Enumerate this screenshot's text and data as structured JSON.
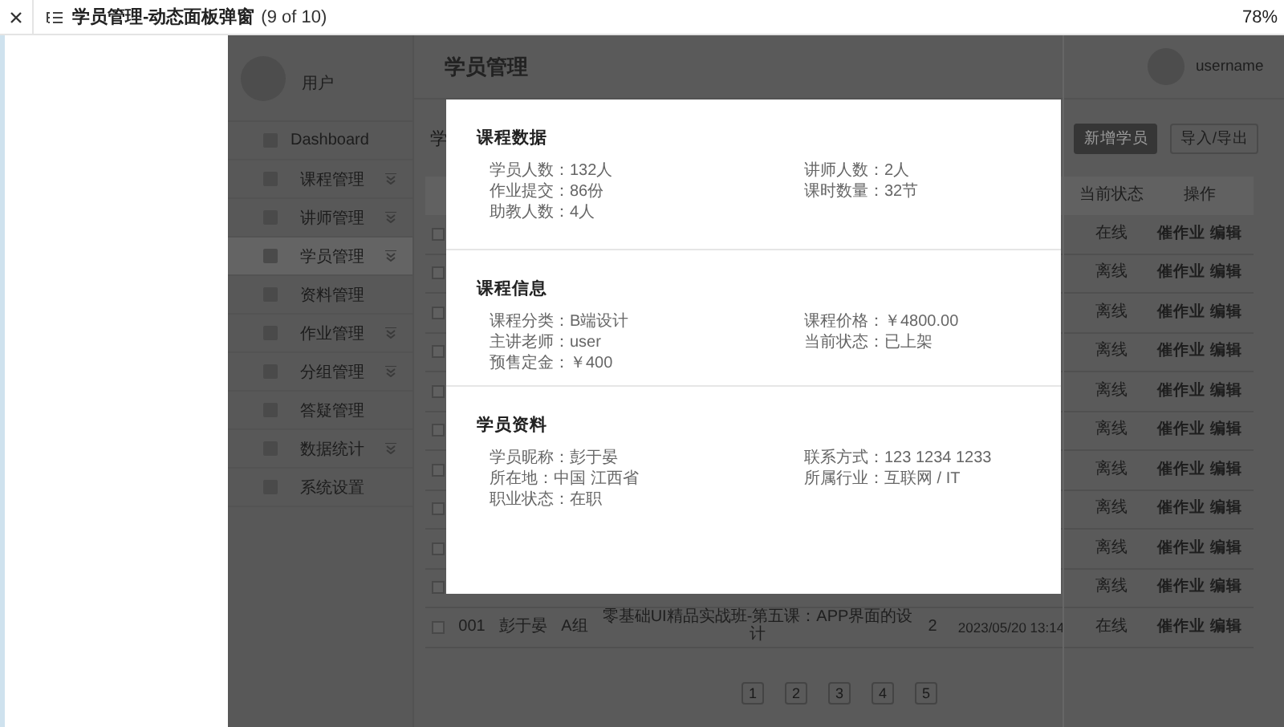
{
  "viewer": {
    "title": "学员管理-动态面板弹窗",
    "page_count": "(9 of 10)",
    "zoom": "78%"
  },
  "sidebar": {
    "user": "用户",
    "items": [
      {
        "label": "Dashboard",
        "expandable": false,
        "selected": false
      },
      {
        "label": "课程管理",
        "expandable": true,
        "selected": false
      },
      {
        "label": "讲师管理",
        "expandable": true,
        "selected": false
      },
      {
        "label": "学员管理",
        "expandable": true,
        "selected": true
      },
      {
        "label": "资料管理",
        "expandable": false,
        "selected": false
      },
      {
        "label": "作业管理",
        "expandable": true,
        "selected": false
      },
      {
        "label": "分组管理",
        "expandable": true,
        "selected": false
      },
      {
        "label": "答疑管理",
        "expandable": false,
        "selected": false
      },
      {
        "label": "数据统计",
        "expandable": true,
        "selected": false
      },
      {
        "label": "系统设置",
        "expandable": false,
        "selected": false
      }
    ]
  },
  "header": {
    "title": "学员管理",
    "username": "username"
  },
  "toolbar": {
    "section_title": "学",
    "buttons": [
      {
        "label": "新增学员",
        "kind": "primary"
      },
      {
        "label": "导入/导出",
        "kind": "outline"
      }
    ]
  },
  "table": {
    "columns": [
      "当前状态",
      "操作"
    ],
    "rows": [
      {
        "checked": false,
        "cells": [],
        "status": "在线",
        "actions": [
          "催作业",
          "编辑"
        ]
      },
      {
        "checked": false,
        "cells": [],
        "status": "离线",
        "actions": [
          "催作业",
          "编辑"
        ]
      },
      {
        "checked": false,
        "cells": [],
        "status": "离线",
        "actions": [
          "催作业",
          "编辑"
        ]
      },
      {
        "checked": false,
        "cells": [],
        "status": "离线",
        "actions": [
          "催作业",
          "编辑"
        ]
      },
      {
        "checked": false,
        "cells": [],
        "status": "离线",
        "actions": [
          "催作业",
          "编辑"
        ]
      },
      {
        "checked": false,
        "cells": [],
        "status": "离线",
        "actions": [
          "催作业",
          "编辑"
        ]
      },
      {
        "checked": false,
        "cells": [],
        "status": "离线",
        "actions": [
          "催作业",
          "编辑"
        ]
      },
      {
        "checked": false,
        "cells": [],
        "status": "离线",
        "actions": [
          "催作业",
          "编辑"
        ]
      },
      {
        "checked": false,
        "cells": [],
        "status": "离线",
        "actions": [
          "催作业",
          "编辑"
        ]
      },
      {
        "checked": false,
        "cells": [],
        "status": "离线",
        "actions": [
          "催作业",
          "编辑"
        ]
      },
      {
        "checked": false,
        "cells": [
          "001",
          "彭于晏",
          "A组",
          "零基础UI精品实战班-第五课：APP界面的设计",
          "2",
          "2023/05/20 13:14"
        ],
        "status": "在线",
        "actions": [
          "催作业",
          "编辑"
        ]
      }
    ]
  },
  "pagination": [
    "1",
    "2",
    "3",
    "4",
    "5"
  ],
  "modal": {
    "sections": [
      {
        "title": "课程数据",
        "fields": [
          "学员人数：132人",
          "讲师人数：2人",
          "作业提交：86份",
          "课时数量：32节",
          "助教人数：4人"
        ]
      },
      {
        "title": "课程信息",
        "fields": [
          "课程分类：B端设计",
          "课程价格：￥4800.00",
          "主讲老师：user",
          "当前状态：已上架",
          "预售定金：￥400"
        ]
      },
      {
        "title": "学员资料",
        "fields": [
          "学员昵称：彭于晏",
          "联系方式：123 1234 1233",
          "所在地：中国  江西省",
          "所属行业：互联网 / IT",
          "职业状态：在职"
        ]
      }
    ]
  }
}
